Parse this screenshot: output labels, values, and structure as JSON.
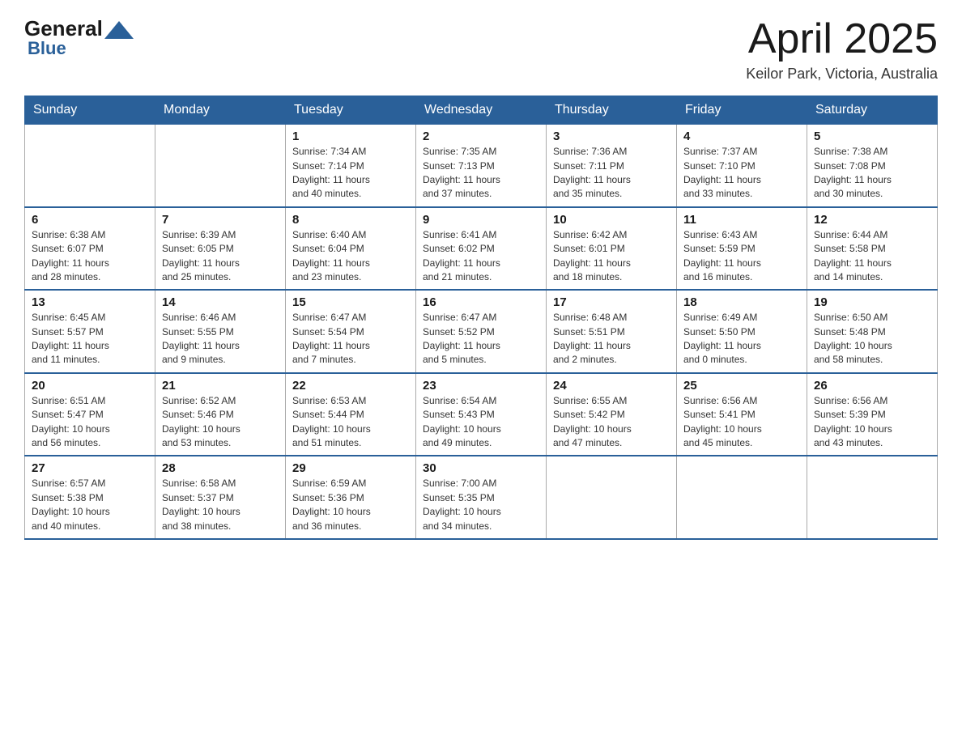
{
  "logo": {
    "general": "General",
    "blue": "Blue"
  },
  "title": "April 2025",
  "location": "Keilor Park, Victoria, Australia",
  "headers": [
    "Sunday",
    "Monday",
    "Tuesday",
    "Wednesday",
    "Thursday",
    "Friday",
    "Saturday"
  ],
  "weeks": [
    [
      {
        "day": "",
        "info": ""
      },
      {
        "day": "",
        "info": ""
      },
      {
        "day": "1",
        "info": "Sunrise: 7:34 AM\nSunset: 7:14 PM\nDaylight: 11 hours\nand 40 minutes."
      },
      {
        "day": "2",
        "info": "Sunrise: 7:35 AM\nSunset: 7:13 PM\nDaylight: 11 hours\nand 37 minutes."
      },
      {
        "day": "3",
        "info": "Sunrise: 7:36 AM\nSunset: 7:11 PM\nDaylight: 11 hours\nand 35 minutes."
      },
      {
        "day": "4",
        "info": "Sunrise: 7:37 AM\nSunset: 7:10 PM\nDaylight: 11 hours\nand 33 minutes."
      },
      {
        "day": "5",
        "info": "Sunrise: 7:38 AM\nSunset: 7:08 PM\nDaylight: 11 hours\nand 30 minutes."
      }
    ],
    [
      {
        "day": "6",
        "info": "Sunrise: 6:38 AM\nSunset: 6:07 PM\nDaylight: 11 hours\nand 28 minutes."
      },
      {
        "day": "7",
        "info": "Sunrise: 6:39 AM\nSunset: 6:05 PM\nDaylight: 11 hours\nand 25 minutes."
      },
      {
        "day": "8",
        "info": "Sunrise: 6:40 AM\nSunset: 6:04 PM\nDaylight: 11 hours\nand 23 minutes."
      },
      {
        "day": "9",
        "info": "Sunrise: 6:41 AM\nSunset: 6:02 PM\nDaylight: 11 hours\nand 21 minutes."
      },
      {
        "day": "10",
        "info": "Sunrise: 6:42 AM\nSunset: 6:01 PM\nDaylight: 11 hours\nand 18 minutes."
      },
      {
        "day": "11",
        "info": "Sunrise: 6:43 AM\nSunset: 5:59 PM\nDaylight: 11 hours\nand 16 minutes."
      },
      {
        "day": "12",
        "info": "Sunrise: 6:44 AM\nSunset: 5:58 PM\nDaylight: 11 hours\nand 14 minutes."
      }
    ],
    [
      {
        "day": "13",
        "info": "Sunrise: 6:45 AM\nSunset: 5:57 PM\nDaylight: 11 hours\nand 11 minutes."
      },
      {
        "day": "14",
        "info": "Sunrise: 6:46 AM\nSunset: 5:55 PM\nDaylight: 11 hours\nand 9 minutes."
      },
      {
        "day": "15",
        "info": "Sunrise: 6:47 AM\nSunset: 5:54 PM\nDaylight: 11 hours\nand 7 minutes."
      },
      {
        "day": "16",
        "info": "Sunrise: 6:47 AM\nSunset: 5:52 PM\nDaylight: 11 hours\nand 5 minutes."
      },
      {
        "day": "17",
        "info": "Sunrise: 6:48 AM\nSunset: 5:51 PM\nDaylight: 11 hours\nand 2 minutes."
      },
      {
        "day": "18",
        "info": "Sunrise: 6:49 AM\nSunset: 5:50 PM\nDaylight: 11 hours\nand 0 minutes."
      },
      {
        "day": "19",
        "info": "Sunrise: 6:50 AM\nSunset: 5:48 PM\nDaylight: 10 hours\nand 58 minutes."
      }
    ],
    [
      {
        "day": "20",
        "info": "Sunrise: 6:51 AM\nSunset: 5:47 PM\nDaylight: 10 hours\nand 56 minutes."
      },
      {
        "day": "21",
        "info": "Sunrise: 6:52 AM\nSunset: 5:46 PM\nDaylight: 10 hours\nand 53 minutes."
      },
      {
        "day": "22",
        "info": "Sunrise: 6:53 AM\nSunset: 5:44 PM\nDaylight: 10 hours\nand 51 minutes."
      },
      {
        "day": "23",
        "info": "Sunrise: 6:54 AM\nSunset: 5:43 PM\nDaylight: 10 hours\nand 49 minutes."
      },
      {
        "day": "24",
        "info": "Sunrise: 6:55 AM\nSunset: 5:42 PM\nDaylight: 10 hours\nand 47 minutes."
      },
      {
        "day": "25",
        "info": "Sunrise: 6:56 AM\nSunset: 5:41 PM\nDaylight: 10 hours\nand 45 minutes."
      },
      {
        "day": "26",
        "info": "Sunrise: 6:56 AM\nSunset: 5:39 PM\nDaylight: 10 hours\nand 43 minutes."
      }
    ],
    [
      {
        "day": "27",
        "info": "Sunrise: 6:57 AM\nSunset: 5:38 PM\nDaylight: 10 hours\nand 40 minutes."
      },
      {
        "day": "28",
        "info": "Sunrise: 6:58 AM\nSunset: 5:37 PM\nDaylight: 10 hours\nand 38 minutes."
      },
      {
        "day": "29",
        "info": "Sunrise: 6:59 AM\nSunset: 5:36 PM\nDaylight: 10 hours\nand 36 minutes."
      },
      {
        "day": "30",
        "info": "Sunrise: 7:00 AM\nSunset: 5:35 PM\nDaylight: 10 hours\nand 34 minutes."
      },
      {
        "day": "",
        "info": ""
      },
      {
        "day": "",
        "info": ""
      },
      {
        "day": "",
        "info": ""
      }
    ]
  ]
}
